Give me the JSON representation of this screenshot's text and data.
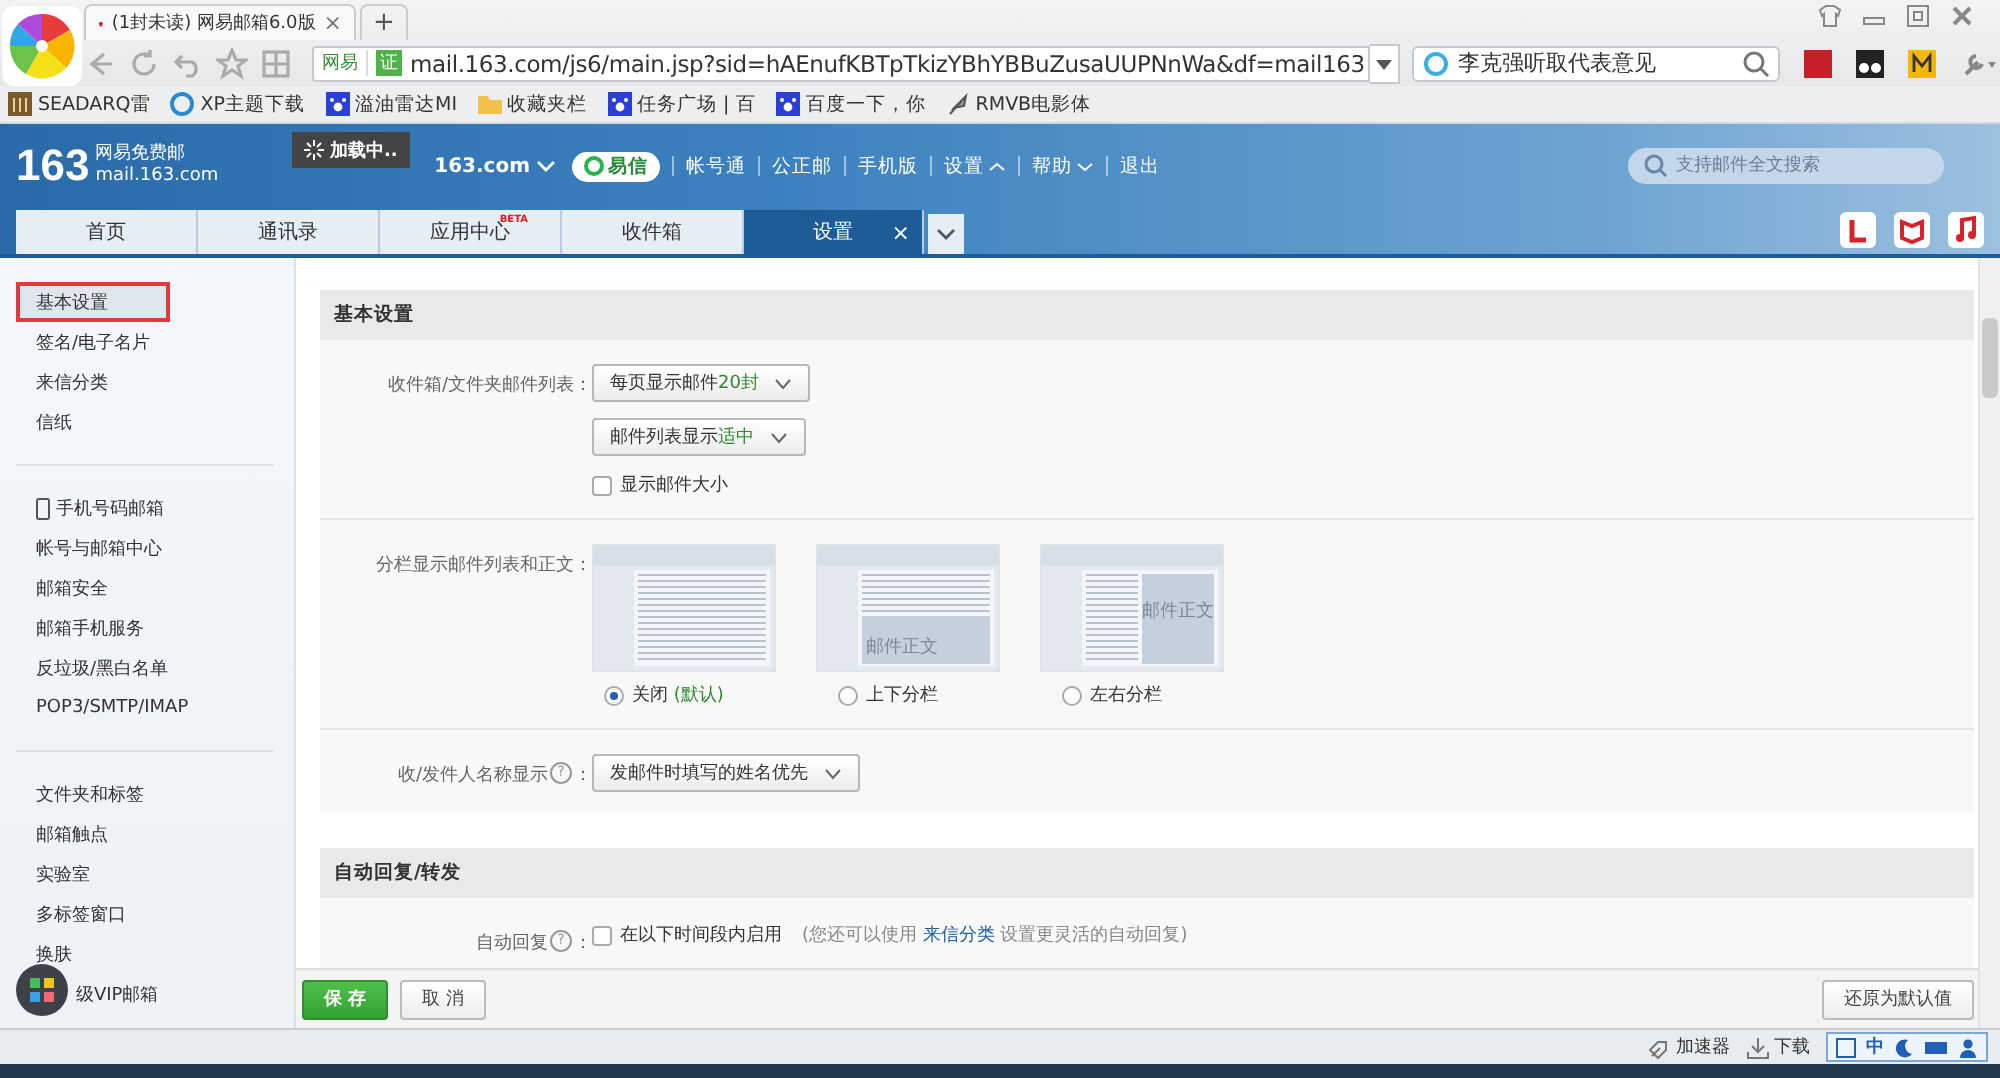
{
  "browser": {
    "tabs": [
      {
        "title": "(1封未读) 网易邮箱6.0版",
        "selected": true,
        "close": "×"
      }
    ],
    "new_tab": "+",
    "address": {
      "prefix": "网易",
      "badge": "证",
      "url": "mail.163.com/js6/main.jsp?sid=hAEnufKBTpTkizYBhYBBuZusaUUPNnWa&df=mail163"
    },
    "search": {
      "value": "李克强听取代表意见"
    },
    "bookmarks": [
      {
        "label": "SEADARQ雷",
        "kind": "brown"
      },
      {
        "label": "XP主题下载",
        "kind": "globe"
      },
      {
        "label": "溢油雷达MI",
        "kind": "paw"
      },
      {
        "label": "收藏夹栏",
        "kind": "folder"
      },
      {
        "label": "任务广场 | 百",
        "kind": "paw"
      },
      {
        "label": "百度一下，你",
        "kind": "paw"
      },
      {
        "label": "RMVB电影体",
        "kind": "feather"
      }
    ]
  },
  "mail": {
    "logo": {
      "number": "163",
      "name": "网易免费邮",
      "domain": "mail.163.com"
    },
    "account": "163.com",
    "loading": "加载中..",
    "nav": [
      {
        "label": "易信",
        "kind": "pill"
      },
      {
        "label": "帐号通",
        "kind": "link"
      },
      {
        "label": "公正邮",
        "kind": "link"
      },
      {
        "label": "手机版",
        "kind": "link"
      },
      {
        "label": "设置",
        "kind": "menu"
      },
      {
        "label": "帮助",
        "kind": "menu"
      },
      {
        "label": "退出",
        "kind": "link"
      }
    ],
    "search": {
      "placeholder": "支持邮件全文搜索"
    },
    "tabs": [
      {
        "label": "首页",
        "selected": false
      },
      {
        "label": "通讯录",
        "selected": false
      },
      {
        "label": "应用中心",
        "badge": "BETA",
        "selected": false
      },
      {
        "label": "收件箱",
        "selected": false
      },
      {
        "label": "设置",
        "selected": true,
        "close": "×"
      }
    ]
  },
  "sidebar": {
    "groups": [
      [
        {
          "label": "基本设置",
          "selected": true
        },
        {
          "label": "签名/电子名片",
          "selected": false
        },
        {
          "label": "来信分类",
          "selected": false
        },
        {
          "label": "信纸",
          "selected": false
        }
      ],
      [
        {
          "label": "手机号码邮箱",
          "selected": false,
          "phone": true
        },
        {
          "label": "帐号与邮箱中心",
          "selected": false
        },
        {
          "label": "邮箱安全",
          "selected": false
        },
        {
          "label": "邮箱手机服务",
          "selected": false
        },
        {
          "label": "反垃圾/黑白名单",
          "selected": false
        },
        {
          "label": "POP3/SMTP/IMAP",
          "selected": false
        }
      ],
      [
        {
          "label": "文件夹和标签",
          "selected": false
        },
        {
          "label": "邮箱触点",
          "selected": false
        },
        {
          "label": "实验室",
          "selected": false
        },
        {
          "label": "多标签窗口",
          "selected": false
        },
        {
          "label": "换肤",
          "selected": false
        },
        {
          "label": "级VIP邮箱",
          "selected": false
        }
      ]
    ]
  },
  "sections": [
    {
      "title": "基本设置",
      "rows": [
        {
          "label": "收件箱/文件夹邮件列表：",
          "controls": [
            {
              "kind": "select",
              "text": "每页显示邮件",
              "accent": "20封"
            },
            {
              "kind": "select",
              "text": "邮件列表显示",
              "accent": "适中"
            },
            {
              "kind": "checkbox",
              "label": "显示邮件大小",
              "checked": false
            }
          ]
        },
        {
          "label": "分栏显示邮件列表和正文：",
          "controls": [
            {
              "kind": "layouts",
              "options": [
                {
                  "kind": "none",
                  "label": "关闭",
                  "note": "(默认)",
                  "selected": true
                },
                {
                  "kind": "bottom",
                  "body": "邮件正文",
                  "label": "上下分栏",
                  "selected": false
                },
                {
                  "kind": "right",
                  "body": "邮件正文",
                  "label": "左右分栏",
                  "selected": false
                }
              ]
            }
          ]
        },
        {
          "label": "收/发件人名称显示",
          "help": "?",
          "colon": "：",
          "controls": [
            {
              "kind": "select",
              "text": "发邮件时填写的姓名优先"
            }
          ]
        }
      ]
    },
    {
      "title": "自动回复/转发",
      "rows": [
        {
          "label": "自动回复",
          "help": "?",
          "colon": "：",
          "controls": [
            {
              "kind": "checkbox",
              "label": "在以下时间段内启用",
              "checked": false,
              "hint": "(您还可以使用",
              "link": "来信分类",
              "hint2": "设置更灵活的自动回复)"
            }
          ]
        }
      ]
    }
  ],
  "footer": {
    "buttons": [
      {
        "label": "保 存",
        "kind": "primary"
      },
      {
        "label": "取 消",
        "kind": "normal"
      }
    ],
    "reset": "还原为默认值"
  },
  "status": {
    "items": [
      "加速器",
      "下载"
    ],
    "ime": "中"
  }
}
